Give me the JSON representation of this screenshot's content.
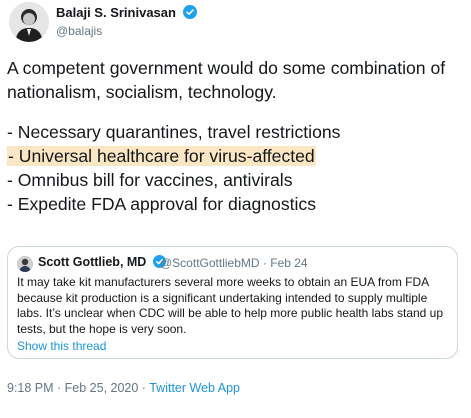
{
  "author": {
    "name": "Balaji S. Srinivasan",
    "handle": "@balajis",
    "verified": true
  },
  "tweet": {
    "lines": [
      "A competent government would do some combination of",
      "nationalism, socialism, technology."
    ],
    "bullets": [
      "- Necessary quarantines, travel restrictions",
      "- Universal healthcare for virus-affected",
      "- Omnibus bill for vaccines, antivirals",
      "- Expedite FDA approval for diagnostics"
    ],
    "highlighted_bullet_index": 1,
    "highlight_color": "#fbe7c3"
  },
  "quoted_tweet": {
    "name": "Scott Gottlieb, MD",
    "handle": "@ScottGottliebMD",
    "separator": "·",
    "date": "Feb 24",
    "lines": [
      "It may take kit manufacturers several more weeks to obtain an EUA from FDA",
      "because kit production is a significant undertaking intended to supply multiple",
      "labs. It’s unclear when CDC will be able to help more public health labs stand up",
      "tests, but the hope is very soon."
    ],
    "show_thread_label": "Show this thread"
  },
  "footer": {
    "timestamp": "9:18 PM · Feb 25, 2020 · ",
    "source": "Twitter Web App"
  },
  "colors": {
    "link": "#1b95e0",
    "secondary": "#657786",
    "border": "#ccd6dd",
    "verified": "#1da1f2"
  }
}
